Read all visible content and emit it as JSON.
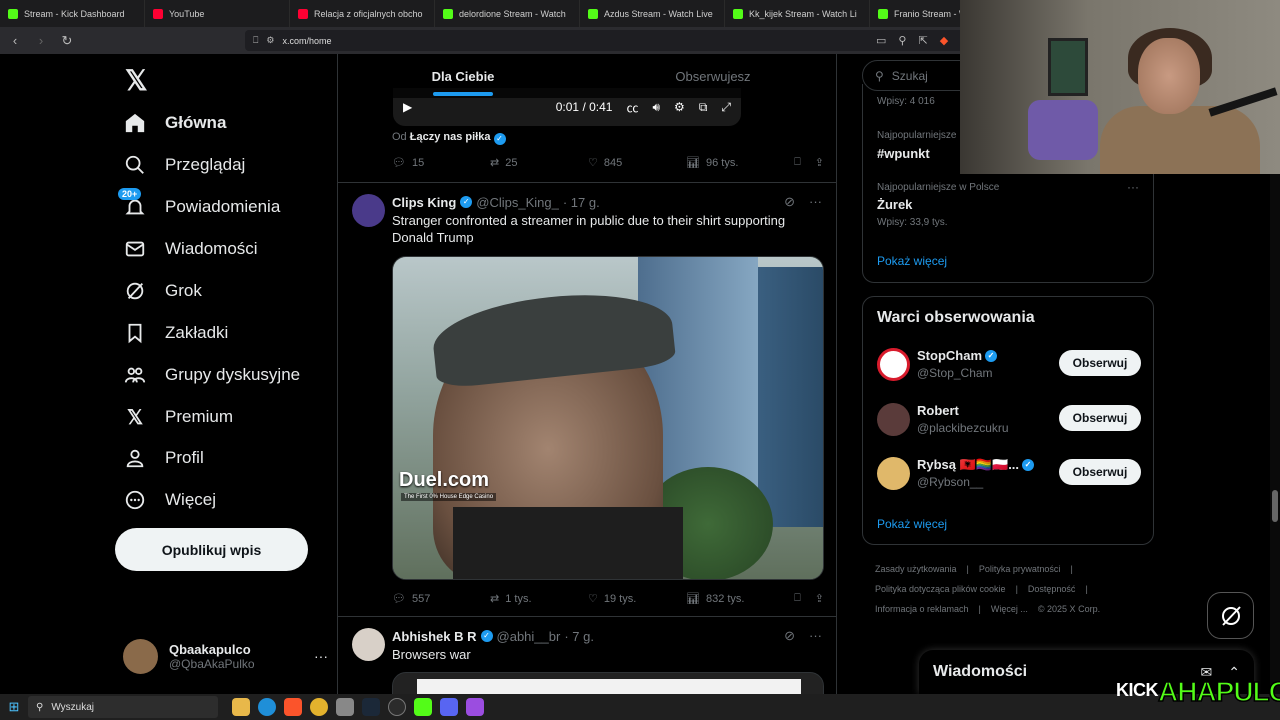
{
  "browser": {
    "tabs": [
      {
        "label": "Stream - Kick Dashboard",
        "color": "#53fc18"
      },
      {
        "label": "YouTube",
        "color": "#ff0033"
      },
      {
        "label": "Relacja z oficjalnych obcho",
        "color": "#ff0033"
      },
      {
        "label": "delordione Stream - Watch",
        "color": "#53fc18"
      },
      {
        "label": "Azdus Stream - Watch Live",
        "color": "#53fc18"
      },
      {
        "label": "Kk_kijek Stream - Watch Li",
        "color": "#53fc18"
      },
      {
        "label": "Franio Stream - Wat",
        "color": "#53fc18"
      }
    ],
    "url": "x.com/home"
  },
  "sidebar": {
    "logo": "𝕏",
    "items": [
      {
        "label": "Główna",
        "icon": "home-icon",
        "glyph": "⌂"
      },
      {
        "label": "Przeglądaj",
        "icon": "search-icon",
        "glyph": "⚲"
      },
      {
        "label": "Powiadomienia",
        "icon": "bell-icon",
        "glyph": "🔔︎"
      },
      {
        "label": "Wiadomości",
        "icon": "mail-icon",
        "glyph": "✉"
      },
      {
        "label": "Grok",
        "icon": "grok-icon",
        "glyph": "⊘"
      },
      {
        "label": "Zakładki",
        "icon": "bookmark-icon",
        "glyph": "⎕"
      },
      {
        "label": "Grupy dyskusyjne",
        "icon": "communities-icon",
        "glyph": "⚇"
      },
      {
        "label": "Premium",
        "icon": "x-premium-icon",
        "glyph": "𝕏"
      },
      {
        "label": "Profil",
        "icon": "profile-icon",
        "glyph": "♙"
      },
      {
        "label": "Więcej",
        "icon": "more-circle-icon",
        "glyph": "⋯"
      }
    ],
    "notifications_badge": "20+",
    "post_button": "Opublikuj wpis",
    "account": {
      "name": "Qbaakapulco",
      "handle": "@QbaAkaPulko",
      "more": "···"
    }
  },
  "main": {
    "tabs": [
      {
        "label": "Dla Ciebie",
        "active": true
      },
      {
        "label": "Obserwujesz",
        "active": false
      }
    ],
    "video": {
      "time": "0:01 / 0:41"
    },
    "prev_tweet": {
      "from_prefix": "Od",
      "from_name": "Łączy nas piłka",
      "replies": "15",
      "reposts": "25",
      "likes": "845",
      "views": "96 tys."
    },
    "tweets": [
      {
        "name": "Clips King",
        "handle": "@Clips_King_",
        "time": "· 17 g.",
        "text": "Stranger confronted a streamer in public due to their shirt supporting Donald Trump",
        "media_watermark": "Duel.com",
        "media_watermark_sub": "The First 0% House Edge Casino",
        "replies": "557",
        "reposts": "1 tys.",
        "likes": "19 tys.",
        "views": "832 tys."
      },
      {
        "name": "Abhishek B R",
        "handle": "@abhi__br",
        "time": "· 7 g.",
        "text": "Browsers war"
      }
    ]
  },
  "right": {
    "search_placeholder": "Szukaj",
    "trends": [
      {
        "meta": "Wpisy: 4 016",
        "title": "",
        "sub": ""
      },
      {
        "meta": "Najpopularniejsze",
        "title": "#wpunkt",
        "sub": ""
      },
      {
        "meta": "Najpopularniejsze w Polsce",
        "title": "Żurek",
        "sub": "Wpisy: 33,9 tys."
      }
    ],
    "show_more": "Pokaż więcej",
    "who_to_follow": {
      "title": "Warci obserwowania",
      "users": [
        {
          "name": "StopCham",
          "handle": "@Stop_Cham",
          "verified": true,
          "button": "Obserwuj",
          "avatar_color": "#d81b2c"
        },
        {
          "name": "Robert",
          "handle": "@plackibezcukru",
          "verified": false,
          "button": "Obserwuj",
          "avatar_color": "#5a3b3a"
        },
        {
          "name": "Rybsą 🇦🇱🏳️‍🌈🇵🇱...",
          "handle": "@Rybson__",
          "verified": true,
          "button": "Obserwuj",
          "avatar_color": "#e0b86a"
        }
      ],
      "show_more": "Pokaż więcej"
    },
    "footer": [
      "Zasady użytkowania",
      "|",
      "Polityka prywatności",
      "|",
      "Polityka dotycząca plików cookie",
      "|",
      "Dostępność",
      "|",
      "Informacja o reklamach",
      "|",
      "Więcej ...",
      "© 2025 X Corp."
    ]
  },
  "messages_drawer": {
    "title": "Wiadomości"
  },
  "taskbar": {
    "search": "Wyszukaj"
  },
  "overlay": {
    "kick": "KICK",
    "brand": "AHAPULCO"
  },
  "colors": {
    "accent": "#1d9bf0",
    "kick_green": "#53fc18",
    "background": "#000000"
  }
}
